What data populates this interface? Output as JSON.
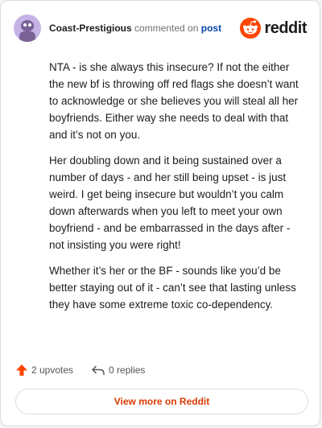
{
  "header": {
    "username": "Coast-Prestigious",
    "action_text": "commented on",
    "post_link": "post",
    "logo_text": "reddit"
  },
  "comment": {
    "paragraphs": [
      "NTA - is she always this insecure? If not the either the new bf is throwing off red flags she doesn’t want to acknowledge or she believes you will steal all her boyfriends. Either way she needs to deal with that and it’s not on you.",
      "Her doubling down and it being sustained over a number of days - and her still being upset - is just weird. I get being insecure but wouldn’t you calm down afterwards when you left to meet your own boyfriend - and be embarrassed in the days after - not insisting you were right!",
      "Whether it’s her or the BF - sounds like you’d be better staying out of it - can’t see that lasting unless they have some extreme toxic co-dependency."
    ]
  },
  "actions": {
    "upvotes": "2 upvotes",
    "replies": "0 replies"
  },
  "footer": {
    "view_more": "View more on Reddit"
  },
  "colors": {
    "accent": "#d93a00",
    "upvote": "#ff4500",
    "link": "#0045ac"
  },
  "icons": {
    "avatar": "snoo-avatar",
    "logo": "reddit-alien-icon",
    "upvote": "upvote-arrow-icon",
    "reply": "reply-arrow-icon"
  }
}
